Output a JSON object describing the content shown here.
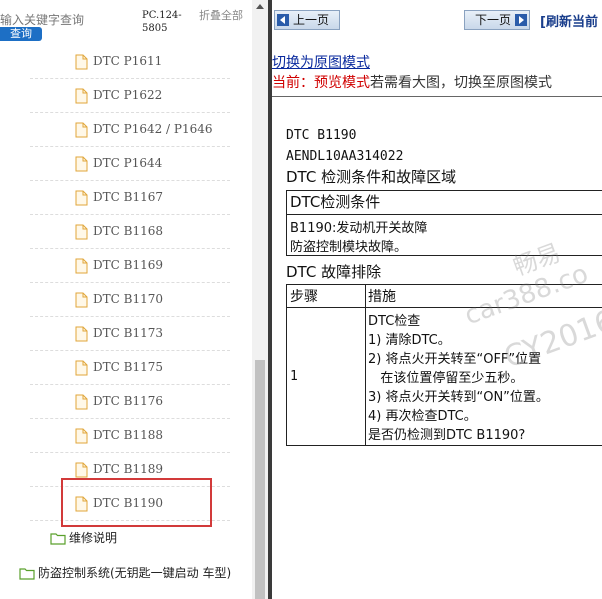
{
  "left_panel": {
    "search_placeholder": "输入关键字查询",
    "search_button": "查询",
    "version": "PC.124-5805",
    "collapse_all": "折叠全部",
    "items": [
      "DTC P1611",
      "DTC P1622",
      "DTC P1642 / P1646",
      "DTC P1644",
      "DTC B1167",
      "DTC B1168",
      "DTC B1169",
      "DTC B1170",
      "DTC B1173",
      "DTC B1175",
      "DTC B1176",
      "DTC B1188",
      "DTC B1189",
      "DTC B1190"
    ],
    "selected_item": "DTC B1190",
    "folders": {
      "repair_notes": "维修说明",
      "anti_theft": "防盗控制系统(无钥匙一键启动 车型)"
    }
  },
  "toolbar": {
    "prev": "上一页",
    "next": "下一页",
    "refresh": "[刷新当前"
  },
  "mode": {
    "switch_link": "切换为原图模式",
    "current_label": "当前：",
    "current_mode": "预览模式",
    "hint": "若需看大图，切换至原图模式"
  },
  "doc": {
    "dtc_code": "DTC B1190",
    "doc_id": "AENDL10AA314022",
    "section1_title": "DTC 检测条件和故障区域",
    "condition_header": "DTC检测条件",
    "condition_line1": "B1190:发动机开关故障",
    "condition_line2": "防盗控制模块故障。",
    "section2_title": "DTC 故障排除",
    "table_header_step": "步骤",
    "table_header_action": "措施",
    "step_no": "1",
    "actions": [
      "DTC检查",
      "1) 清除DTC。",
      "2) 将点火开关转至“OFF”位置",
      "   在该位置停留至少五秒。",
      "3) 将点火开关转到“ON”位置。",
      "4) 再次检查DTC。",
      "是否仍检测到DTC B1190?"
    ]
  },
  "watermark": {
    "line1": "畅易",
    "line2": "car388.co",
    "line3": "CY2016"
  },
  "colors": {
    "highlight": "#d23a3a",
    "search_button": "#1d6fc5",
    "link": "#0a2a9e",
    "mode_red": "#d00000"
  }
}
